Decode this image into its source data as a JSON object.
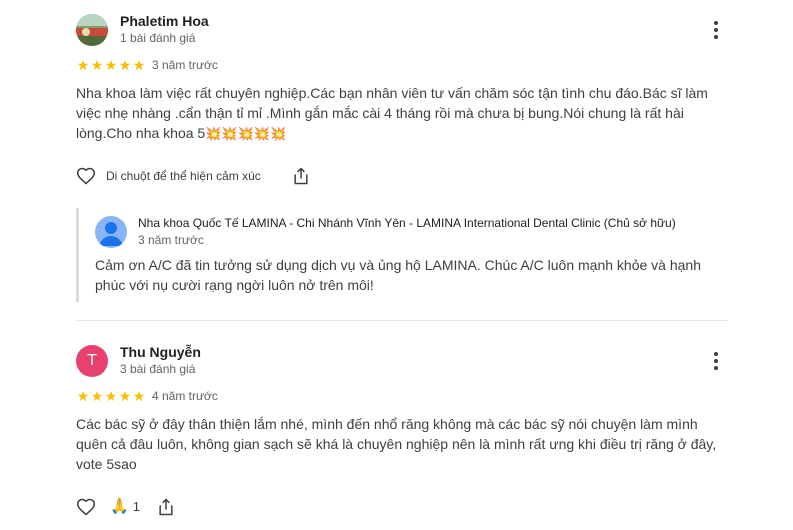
{
  "reviews": [
    {
      "author": "Phaletim Hoa",
      "review_count": "1 bài đánh giá",
      "rating": 5,
      "time": "3 năm trước",
      "text": "Nha khoa làm việc rất chuyên nghiệp.Các bạn nhân viên tư vấn chăm sóc tận tình chu đáo.Bác sĩ làm việc nhẹ nhàng .cẩn thận tỉ mỉ .Mình gắn mắc cài 4 tháng rồi mà chưa bị bung.Nói chung là rất hài lòng.Cho nha khoa 5",
      "emoji": "💥💥💥💥💥",
      "like_hint": "Di chuột để thể hiện cảm xúc",
      "owner_reply": {
        "name": "Nha khoa Quốc Tế LAMINA - Chi Nhánh Vĩnh Yên - LAMINA International Dental Clinic (Chủ sở hữu)",
        "time": "3 năm trước",
        "text": "Cảm ơn A/C đã tin tưởng sử dụng dịch vụ và ủng hộ LAMINA. Chúc A/C luôn mạnh khỏe và hạnh phúc với nụ cười rạng ngời luôn nở trên môi!"
      }
    },
    {
      "author": "Thu Nguyễn",
      "avatar_letter": "T",
      "avatar_color": "#e8416f",
      "review_count": "3 bài đánh giá",
      "rating": 5,
      "time": "4 năm trước",
      "text": "Các bác sỹ ở đây thân thiện lắm nhé, mình đến nhổ răng không mà các bác sỹ nói chuyện làm mình quên cả đâu luôn, không gian sạch sẽ khá là chuyên nghiệp nên là mình rất ưng khi điều trị răng ở đây, vote 5sao",
      "reaction_emoji": "🙏",
      "reaction_count": "1"
    }
  ],
  "colors": {
    "star": "#fbbc04",
    "owner_avatar": "#8ab4f8"
  },
  "icons": [
    "more-vert-icon",
    "heart-outline-icon",
    "share-icon",
    "person-icon",
    "star-icon"
  ]
}
